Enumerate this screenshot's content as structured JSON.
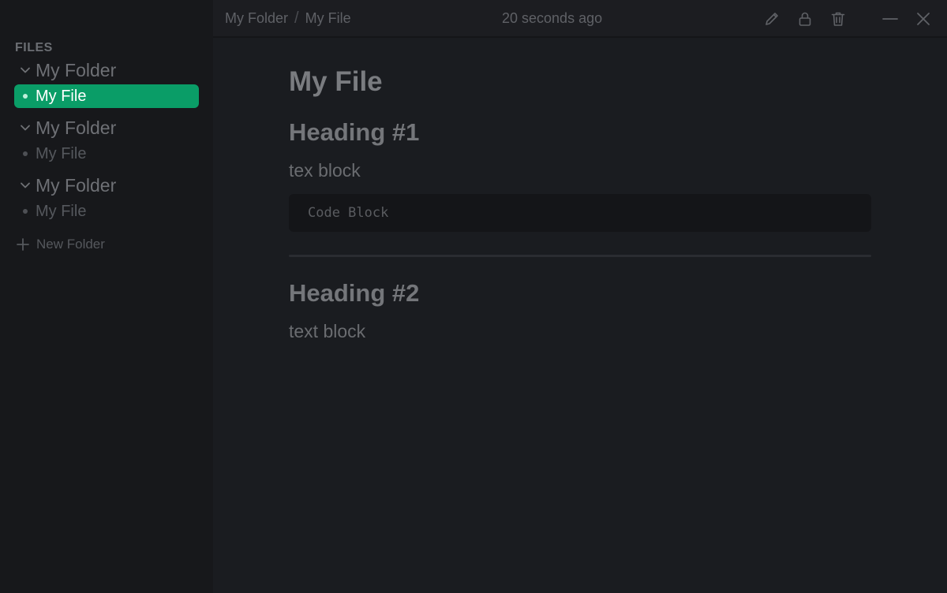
{
  "sidebar": {
    "heading": "FILES",
    "folders": [
      {
        "name": "My Folder",
        "file": "My File",
        "active": true
      },
      {
        "name": "My Folder",
        "file": "My File",
        "active": false
      },
      {
        "name": "My Folder",
        "file": "My File",
        "active": false
      }
    ],
    "new_folder_label": "New Folder"
  },
  "topbar": {
    "breadcrumb": [
      "My Folder",
      "My File"
    ],
    "breadcrumb_separator": "/",
    "timestamp": "20 seconds ago",
    "icons": [
      "pencil-icon",
      "lock-icon",
      "trash-icon",
      "minimize-icon",
      "close-icon"
    ]
  },
  "document": {
    "title": "My File",
    "heading1": "Heading #1",
    "paragraph1": "tex block",
    "code": "Code Block",
    "heading2": "Heading #2",
    "paragraph2": "text block"
  },
  "colors": {
    "accent": "#0a9d67",
    "sidebar_bg": "#17181b",
    "main_bg": "#1a1c20"
  }
}
